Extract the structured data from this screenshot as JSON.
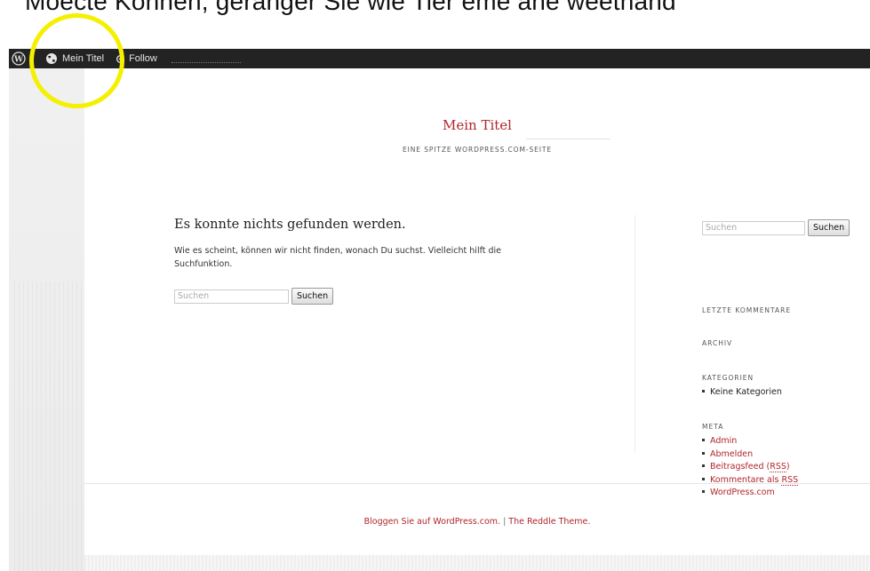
{
  "caption": "Moecte Konnen, geranger Sie wie Tier eme ane weethand",
  "admin_bar": {
    "wp_logo_icon": "wordpress-icon",
    "site_item": {
      "icon": "globe-icon",
      "label": "Mein Titel"
    },
    "follow_item": {
      "icon": "plus-circle-icon",
      "label": "Follow"
    }
  },
  "site": {
    "title": "Mein Titel",
    "description": "EINE SPITZE WORDPRESS.COM-SEITE"
  },
  "main": {
    "heading": "Es konnte nichts gefunden werden.",
    "text": "Wie es scheint, können wir nicht finden, wonach Du suchst. Vielleicht hilft die Suchfunktion.",
    "search_placeholder": "Suchen",
    "search_button": "Suchen"
  },
  "sidebar": {
    "search_placeholder": "Suchen",
    "search_button": "Suchen",
    "recent_comments_heading": "LETZTE KOMMENTARE",
    "archive_heading": "ARCHIV",
    "categories_heading": "KATEGORIEN",
    "categories": [
      "Keine Kategorien"
    ],
    "meta_heading": "META",
    "meta_links": {
      "admin": "Admin",
      "logout": "Abmelden",
      "posts_feed_prefix": "Beitragsfeed (",
      "posts_feed_abbr": "RSS",
      "posts_feed_suffix": ")",
      "comments_feed_prefix": "Kommentare als ",
      "comments_feed_abbr": "RSS",
      "wordpress_com": "WordPress.com"
    }
  },
  "footer": {
    "link1": "Bloggen Sie auf WordPress.com.",
    "separator": " | ",
    "link2": "The Reddle Theme."
  },
  "colors": {
    "accent": "#b0262c",
    "admin_bar": "#232323",
    "highlight": "#f4f000"
  }
}
